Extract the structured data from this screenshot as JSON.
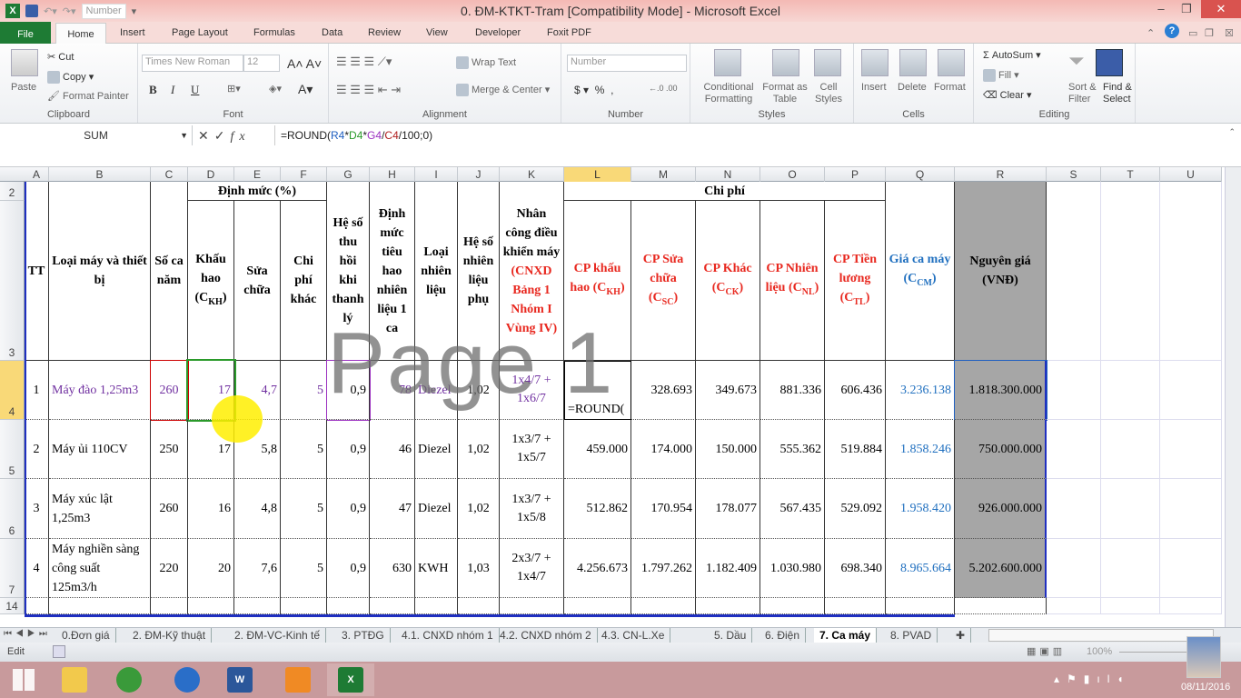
{
  "window": {
    "title": "0. ĐM-KTKT-Tram  [Compatibility Mode]  -  Microsoft Excel",
    "qat_number": "Number"
  },
  "ribbon_tabs": [
    "File",
    "Home",
    "Insert",
    "Page Layout",
    "Formulas",
    "Data",
    "Review",
    "View",
    "Developer",
    "Foxit PDF"
  ],
  "ribbon": {
    "clipboard": {
      "label": "Clipboard",
      "paste": "Paste",
      "cut": "Cut",
      "copy": "Copy",
      "format_painter": "Format Painter"
    },
    "font": {
      "label": "Font",
      "font_name": "Times New Roman",
      "font_size": "12",
      "bold": "B",
      "italic": "I",
      "underline": "U"
    },
    "alignment": {
      "label": "Alignment",
      "wrap": "Wrap Text",
      "merge": "Merge & Center"
    },
    "number": {
      "label": "Number",
      "format": "Number",
      "currency": "$",
      "percent": "%",
      "comma": ","
    },
    "styles": {
      "label": "Styles",
      "conditional": "Conditional Formatting",
      "format_table": "Format as Table",
      "cell_styles": "Cell Styles"
    },
    "cells": {
      "label": "Cells",
      "insert": "Insert",
      "delete": "Delete",
      "format": "Format"
    },
    "editing": {
      "label": "Editing",
      "autosum": "AutoSum",
      "fill": "Fill",
      "clear": "Clear",
      "sort": "Sort & Filter",
      "find": "Find & Select"
    }
  },
  "formula_bar": {
    "name_box": "SUM",
    "formula_prefix": "=ROUND(",
    "refs": [
      {
        "t": "R4",
        "c": "#1f5fc0"
      },
      {
        "t": "*",
        "c": "#222"
      },
      {
        "t": "D4",
        "c": "#2a9a2a"
      },
      {
        "t": "*",
        "c": "#222"
      },
      {
        "t": "G4",
        "c": "#9b30c0"
      },
      {
        "t": "/",
        "c": "#222"
      },
      {
        "t": "C4",
        "c": "#b02020"
      }
    ],
    "formula_suffix": "/100;0)"
  },
  "columns": [
    "A",
    "B",
    "C",
    "D",
    "E",
    "F",
    "G",
    "H",
    "I",
    "J",
    "K",
    "L",
    "M",
    "N",
    "O",
    "P",
    "Q",
    "R",
    "S",
    "T",
    "U"
  ],
  "selected_column": "L",
  "row_numbers": [
    "2",
    "3",
    "4",
    "5",
    "6",
    "7",
    "14"
  ],
  "header": {
    "tt": "TT",
    "loai_may": "Loại máy và thiết bị",
    "so_ca": "Số ca năm",
    "dinh_muc": "Định mức (%)",
    "khau_hao": {
      "t": "Khấu hao (C",
      "sub": "KH",
      "end": ")"
    },
    "sua_chua": "Sửa chữa",
    "chi_phi_khac": "Chi phí khác",
    "he_so_thu_hoi": "Hệ số thu hồi khi thanh lý",
    "dinh_muc_nl": "Định mức tiêu hao nhiên liệu 1 ca",
    "loai_nl": "Loại nhiên liệu",
    "he_so_nl": "Hệ số nhiên liệu phụ",
    "nhan_cong": "Nhân công điều khiển máy",
    "nhan_cong_red": "(CNXD Bảng 1 Nhóm I Vùng IV)",
    "chi_phi": "Chi phí",
    "cp_kh": {
      "t": "CP khấu hao (C",
      "sub": "KH",
      "end": ")"
    },
    "cp_sc": {
      "t": "CP Sửa chữa (C",
      "sub": "SC",
      "end": ")"
    },
    "cp_ck": {
      "t": "CP Khác (C",
      "sub": "CK",
      "end": ")"
    },
    "cp_nl": {
      "t": "CP Nhiên liệu (C",
      "sub": "NL",
      "end": ")"
    },
    "cp_tl": {
      "t": "CP Tiền lương (C",
      "sub": "TL",
      "end": ")"
    },
    "gia_ca_may": {
      "t": "Giá ca máy (C",
      "sub": "CM",
      "end": ")"
    },
    "nguyen_gia": "Nguyên giá (VNĐ)"
  },
  "rows": [
    {
      "tt": "1",
      "name": "Máy đào 1,25m3",
      "so_ca": "260",
      "kh": "17",
      "sc": "4,7",
      "ck": "5",
      "thu_hoi": "0,9",
      "dm_nl": "78",
      "loai_nl": "Diezel",
      "hs_nl": "1,02",
      "nhan_cong": "1x4/7 + 1x6/7",
      "cp_kh": "=ROUND(",
      "cp_sc": "328.693",
      "cp_ck": "349.673",
      "cp_nl": "881.336",
      "cp_tl": "606.436",
      "gia": "3.236.138",
      "nguyen_gia": "1.818.300.000"
    },
    {
      "tt": "2",
      "name": "Máy ủi 110CV",
      "so_ca": "250",
      "kh": "17",
      "sc": "5,8",
      "ck": "5",
      "thu_hoi": "0,9",
      "dm_nl": "46",
      "loai_nl": "Diezel",
      "hs_nl": "1,02",
      "nhan_cong": "1x3/7 + 1x5/7",
      "cp_kh": "459.000",
      "cp_sc": "174.000",
      "cp_ck": "150.000",
      "cp_nl": "555.362",
      "cp_tl": "519.884",
      "gia": "1.858.246",
      "nguyen_gia": "750.000.000"
    },
    {
      "tt": "3",
      "name": "Máy xúc lật 1,25m3",
      "so_ca": "260",
      "kh": "16",
      "sc": "4,8",
      "ck": "5",
      "thu_hoi": "0,9",
      "dm_nl": "47",
      "loai_nl": "Diezel",
      "hs_nl": "1,02",
      "nhan_cong": "1x3/7 + 1x5/8",
      "cp_kh": "512.862",
      "cp_sc": "170.954",
      "cp_ck": "178.077",
      "cp_nl": "567.435",
      "cp_tl": "529.092",
      "gia": "1.958.420",
      "nguyen_gia": "926.000.000"
    },
    {
      "tt": "4",
      "name": "Máy nghiền sàng công suất 125m3/h",
      "so_ca": "220",
      "kh": "20",
      "sc": "7,6",
      "ck": "5",
      "thu_hoi": "0,9",
      "dm_nl": "630",
      "loai_nl": "KWH",
      "hs_nl": "1,03",
      "nhan_cong": "2x3/7 + 1x4/7",
      "cp_kh": "4.256.673",
      "cp_sc": "1.797.262",
      "cp_ck": "1.182.409",
      "cp_nl": "1.030.980",
      "cp_tl": "698.340",
      "gia": "8.965.664",
      "nguyen_gia": "5.202.600.000"
    }
  ],
  "watermark": "Page 1",
  "sheet_tabs": [
    "0.Đơn giá",
    "2. ĐM-Kỹ thuật",
    "2. ĐM-VC-Kinh tế",
    "3. PTĐG",
    "4.1. CNXD nhóm 1",
    "4.2. CNXD nhóm 2",
    "4.3. CN-L.Xe",
    "5. Dầu",
    "6. Điện",
    "7. Ca máy",
    "8. PVAD"
  ],
  "active_sheet": "7. Ca máy",
  "status": {
    "mode": "Edit",
    "zoom": "100%"
  },
  "taskbar": {
    "date": "08/11/2016",
    "apps": [
      "windows-start",
      "file-explorer",
      "coccoc-browser",
      "network-app",
      "word",
      "foxit-pdf",
      "excel"
    ]
  },
  "colors": {
    "accent_red": "#e8281f",
    "accent_blue": "#1f6fbf",
    "file_tab": "#1e7b34",
    "selected_header": "#f9d978"
  }
}
